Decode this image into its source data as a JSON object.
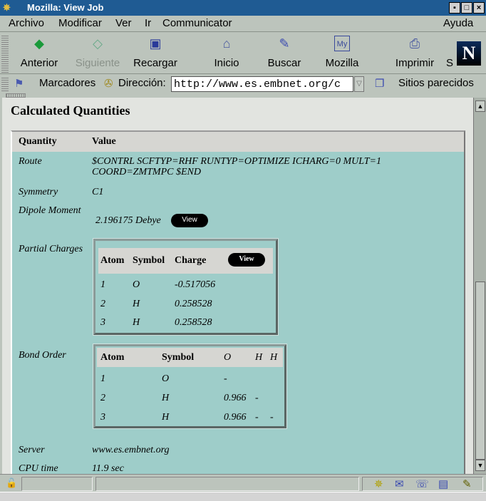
{
  "window": {
    "title": "Mozilla: View Job"
  },
  "menu": [
    "Archivo",
    "Modificar",
    "Ver",
    "Ir",
    "Communicator",
    "Ayuda"
  ],
  "toolbar": [
    {
      "label": "Anterior",
      "icon": "back-arrow-icon"
    },
    {
      "label": "Siguiente",
      "icon": "forward-arrow-icon"
    },
    {
      "label": "Recargar",
      "icon": "reload-icon"
    },
    {
      "label": "Inicio",
      "icon": "home-icon"
    },
    {
      "label": "Buscar",
      "icon": "search-icon"
    },
    {
      "label": "Mozilla",
      "icon": "my-mozilla-icon"
    },
    {
      "label": "Imprimir",
      "icon": "print-icon"
    },
    {
      "label": "S",
      "icon": "security-icon"
    }
  ],
  "location": {
    "bookmarks": "Marcadores",
    "address_label": "Dirección:",
    "url": "http://www.es.embnet.org/c",
    "related": "Sitios parecidos"
  },
  "page": {
    "title": "Calculated Quantities",
    "header": {
      "quantity": "Quantity",
      "value": "Value"
    },
    "route": {
      "label": "Route",
      "line1": "$CONTRL SCFTYP=RHF RUNTYP=OPTIMIZE ICHARG=0 MULT=1",
      "line2": "COORD=ZMTMPC $END"
    },
    "symmetry": {
      "label": "Symmetry",
      "value": "C1"
    },
    "dipole": {
      "label": "Dipole Moment",
      "value": "2.196175 Debye",
      "button": "View"
    },
    "partial_charges": {
      "label": "Partial Charges",
      "headers": [
        "Atom",
        "Symbol",
        "Charge"
      ],
      "button": "View",
      "rows": [
        [
          "1",
          "O",
          "-0.517056"
        ],
        [
          "2",
          "H",
          "0.258528"
        ],
        [
          "3",
          "H",
          "0.258528"
        ]
      ]
    },
    "bond_order": {
      "label": "Bond Order",
      "headers": [
        "Atom",
        "Symbol",
        "O",
        "H",
        "H"
      ],
      "rows": [
        [
          "1",
          "O",
          "-",
          "",
          ""
        ],
        [
          "2",
          "H",
          "0.966",
          "-",
          ""
        ],
        [
          "3",
          "H",
          "0.966",
          "-",
          "-"
        ]
      ]
    },
    "server": {
      "label": "Server",
      "value": "www.es.embnet.org"
    },
    "cpu": {
      "label": "CPU time",
      "value": "11.9 sec"
    }
  }
}
